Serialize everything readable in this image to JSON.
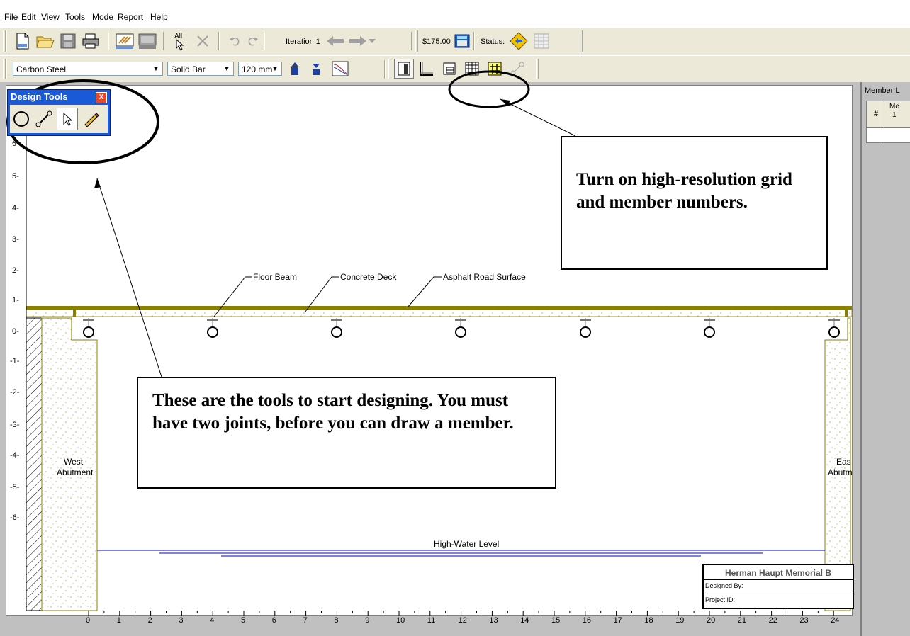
{
  "menu": [
    "File",
    "Edit",
    "View",
    "Tools",
    "Mode",
    "Report",
    "Help"
  ],
  "toolbar1": {
    "iteration_label": "Iteration 1",
    "cost": "$175.00",
    "status_label": "Status:",
    "all_label": "All"
  },
  "toolbar2": {
    "material": "Carbon Steel",
    "cross_section": "Solid Bar",
    "size": "120 mm"
  },
  "design_tools": {
    "title": "Design Tools",
    "close": "X"
  },
  "member_list": {
    "title": "Member L",
    "col_num": "#",
    "col_member": "Me",
    "col_member_2": "1"
  },
  "y_axis": [
    "6-",
    "5-",
    "4-",
    "3-",
    "2-",
    "1-",
    "0-",
    "-1-",
    "-2-",
    "-3-",
    "-4-",
    "-5-",
    "-6-"
  ],
  "x_axis": [
    "0",
    "1",
    "2",
    "3",
    "4",
    "5",
    "6",
    "7",
    "8",
    "9",
    "10",
    "11",
    "12",
    "13",
    "14",
    "15",
    "16",
    "17",
    "18",
    "19",
    "20",
    "21",
    "22",
    "23",
    "24"
  ],
  "labels": {
    "floor_beam": "Floor Beam",
    "concrete_deck": "Concrete Deck",
    "asphalt": "Asphalt Road Surface",
    "west_1": "West",
    "west_2": "Abutment",
    "east_1": "Eas",
    "east_2": "Abutm",
    "high_water": "High-Water Level"
  },
  "title_block": {
    "title": "Herman Haupt Memorial B",
    "designed_by": "Designed By:",
    "project_id": "Project ID:"
  },
  "callouts": {
    "grid": "Turn on high-resolution grid and member numbers.",
    "tools": "These are the tools to start designing. You must have two joints, before you can draw a member."
  },
  "colors": {
    "deck": "#8b8000",
    "water": "#0000cc",
    "titlebar": "#1a5ad9"
  }
}
